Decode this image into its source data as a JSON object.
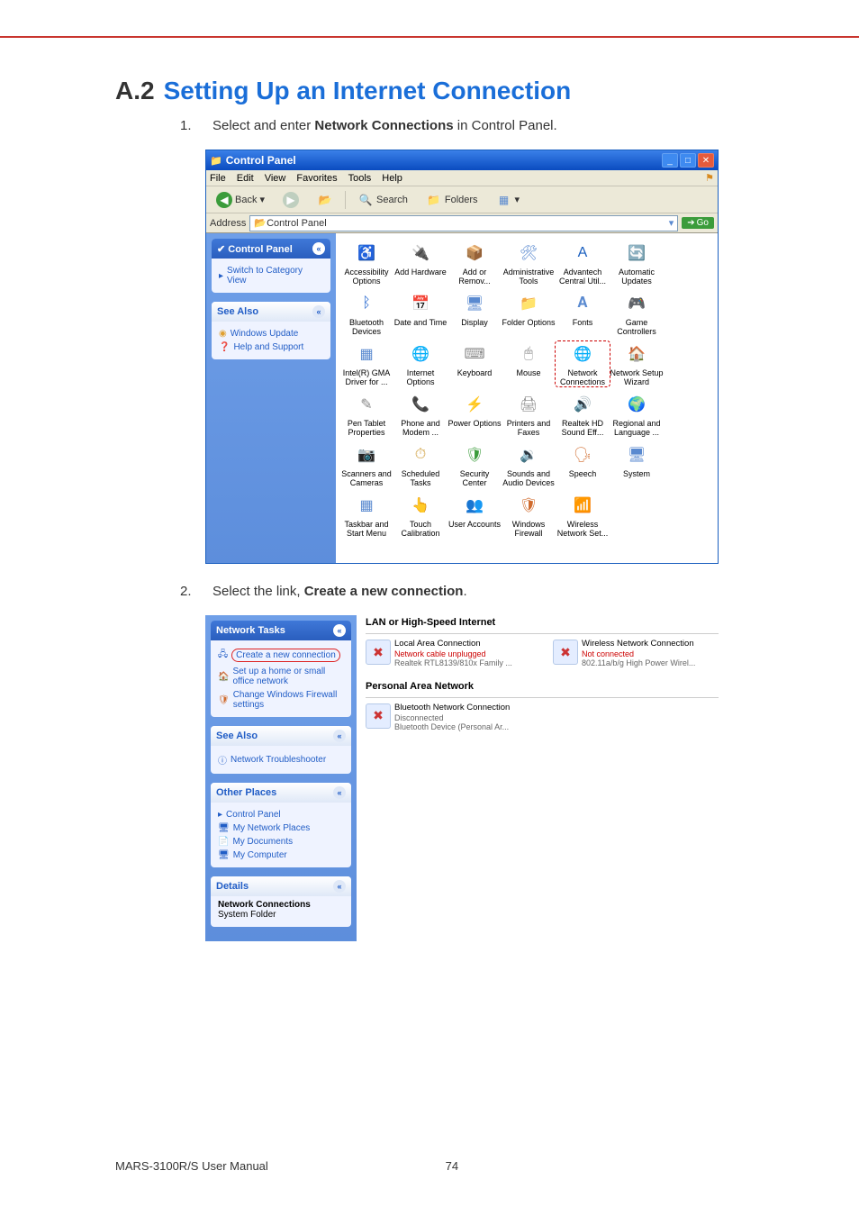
{
  "heading": {
    "num": "A.2",
    "text": "Setting Up an Internet Connection"
  },
  "steps": [
    {
      "n": "1.",
      "pre": "Select and enter ",
      "bold": "Network Connections",
      "post": " in Control Panel."
    },
    {
      "n": "2.",
      "pre": "Select the link, ",
      "bold": "Create a new connection",
      "post": "."
    }
  ],
  "win1": {
    "title": "Control Panel",
    "menus": [
      "File",
      "Edit",
      "View",
      "Favorites",
      "Tools",
      "Help"
    ],
    "toolbar": {
      "back": "Back",
      "search": "Search",
      "folders": "Folders"
    },
    "address_label": "Address",
    "address_value": "Control Panel",
    "go": "Go",
    "side": {
      "cp_title": "Control Panel",
      "switch": "Switch to Category View",
      "see_also": "See Also",
      "see_items": [
        "Windows Update",
        "Help and Support"
      ]
    },
    "icons": [
      "Accessibility Options",
      "Add Hardware",
      "Add or Remov...",
      "Administrative Tools",
      "Advantech Central Util...",
      "Automatic Updates",
      "Bluetooth Devices",
      "Date and Time",
      "Display",
      "Folder Options",
      "Fonts",
      "Game Controllers",
      "Intel(R) GMA Driver for ...",
      "Internet Options",
      "Keyboard",
      "Mouse",
      "Network Connections",
      "Network Setup Wizard",
      "Pen Tablet Properties",
      "Phone and Modem ...",
      "Power Options",
      "Printers and Faxes",
      "Realtek HD Sound Eff...",
      "Regional and Language ...",
      "Scanners and Cameras",
      "Scheduled Tasks",
      "Security Center",
      "Sounds and Audio Devices",
      "Speech",
      "System",
      "Taskbar and Start Menu",
      "Touch Calibration",
      "User Accounts",
      "Windows Firewall",
      "Wireless Network Set..."
    ]
  },
  "win2": {
    "side": {
      "nt_title": "Network Tasks",
      "nt_items": [
        "Create a new connection",
        "Set up a home or small office network",
        "Change Windows Firewall settings"
      ],
      "see_also": "See Also",
      "see_items": [
        "Network Troubleshooter"
      ],
      "op_title": "Other Places",
      "op_items": [
        "Control Panel",
        "My Network Places",
        "My Documents",
        "My Computer"
      ],
      "details_title": "Details",
      "details_name": "Network Connections",
      "details_type": "System Folder"
    },
    "sections": {
      "lan_title": "LAN or High-Speed Internet",
      "lan_items": [
        {
          "name": "Local Area Connection",
          "status": "Network cable unplugged",
          "dev": "Realtek RTL8139/810x Family ..."
        },
        {
          "name": "Wireless Network Connection",
          "status": "Not connected",
          "dev": "802.11a/b/g High Power Wirel..."
        }
      ],
      "pan_title": "Personal Area Network",
      "pan_items": [
        {
          "name": "Bluetooth Network Connection",
          "status": "Disconnected",
          "dev": "Bluetooth Device (Personal Ar..."
        }
      ]
    }
  },
  "footer": {
    "left": "MARS-3100R/S User Manual",
    "page": "74"
  }
}
